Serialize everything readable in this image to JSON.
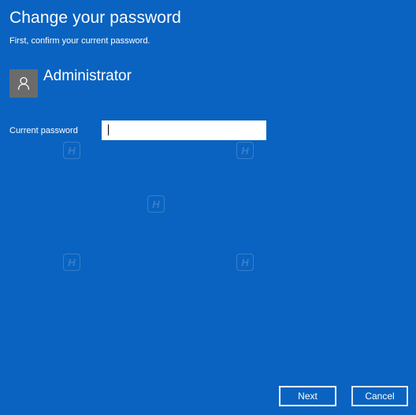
{
  "dialog": {
    "title": "Change your password",
    "subtitle": "First, confirm your current password."
  },
  "user": {
    "name": "Administrator",
    "avatar_icon": "user-silhouette-icon",
    "avatar_color": "#6b6b6b"
  },
  "form": {
    "current_password_label": "Current password",
    "current_password_value": ""
  },
  "buttons": {
    "next_label": "Next",
    "cancel_label": "Cancel"
  },
  "colors": {
    "background": "#0a63c0",
    "text": "#ffffff",
    "input_background": "#ffffff"
  }
}
